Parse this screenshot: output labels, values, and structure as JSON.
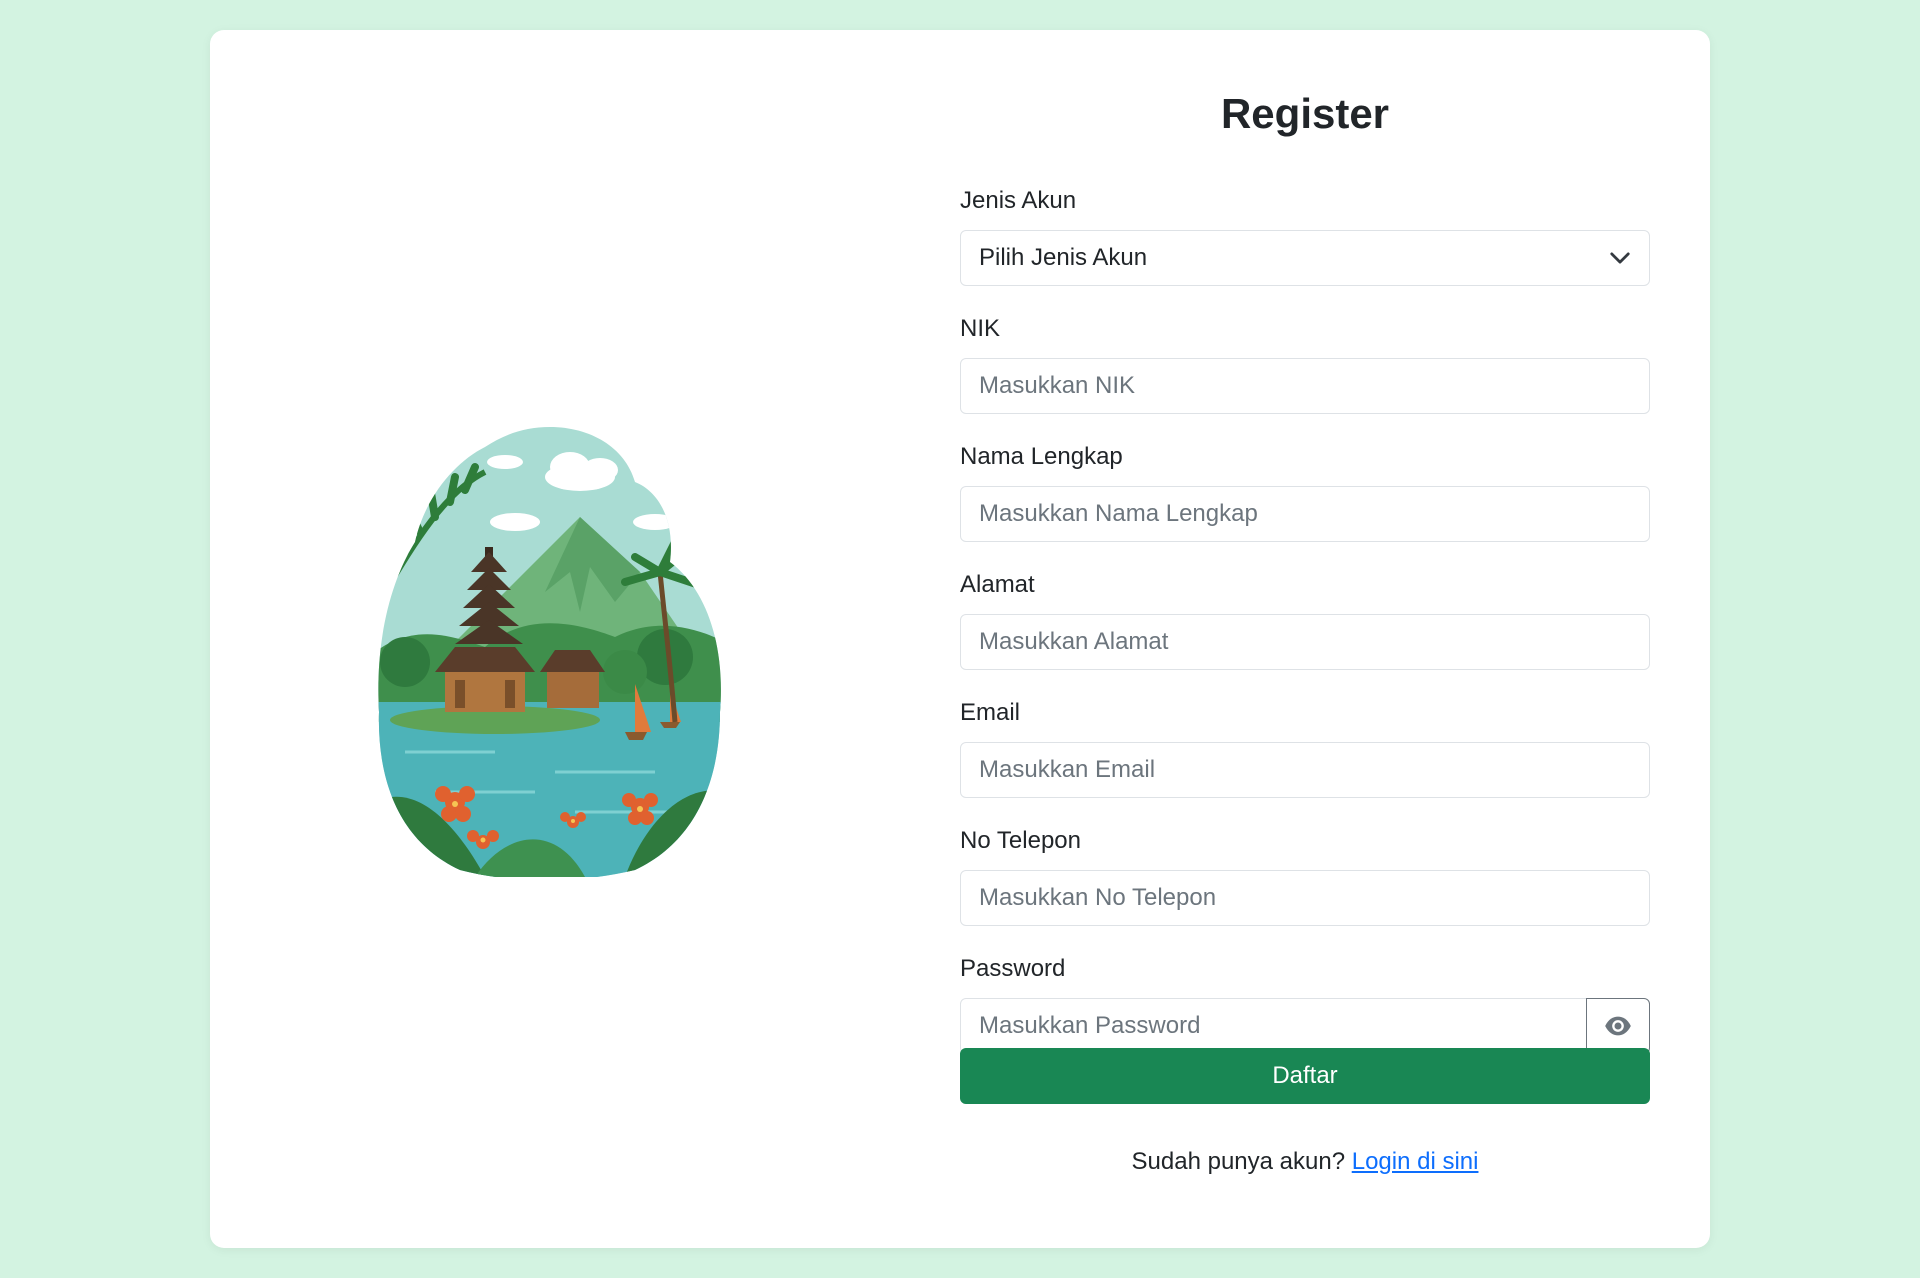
{
  "form": {
    "title": "Register",
    "fields": {
      "account_type": {
        "label": "Jenis Akun",
        "selected": "Pilih Jenis Akun"
      },
      "nik": {
        "label": "NIK",
        "placeholder": "Masukkan NIK"
      },
      "full_name": {
        "label": "Nama Lengkap",
        "placeholder": "Masukkan Nama Lengkap"
      },
      "address": {
        "label": "Alamat",
        "placeholder": "Masukkan Alamat"
      },
      "email": {
        "label": "Email",
        "placeholder": "Masukkan Email"
      },
      "phone": {
        "label": "No Telepon",
        "placeholder": "Masukkan No Telepon"
      },
      "password": {
        "label": "Password",
        "placeholder": "Masukkan Password"
      }
    },
    "submit_label": "Daftar",
    "footer": {
      "prompt": "Sudah punya akun?",
      "link_label": "Login di sini"
    }
  },
  "colors": {
    "page_background": "#d3f3e1",
    "primary_button": "#198754",
    "link": "#0d6efd"
  },
  "icons": {
    "select_indicator": "chevron-down-icon",
    "password_toggle": "eye-icon"
  }
}
